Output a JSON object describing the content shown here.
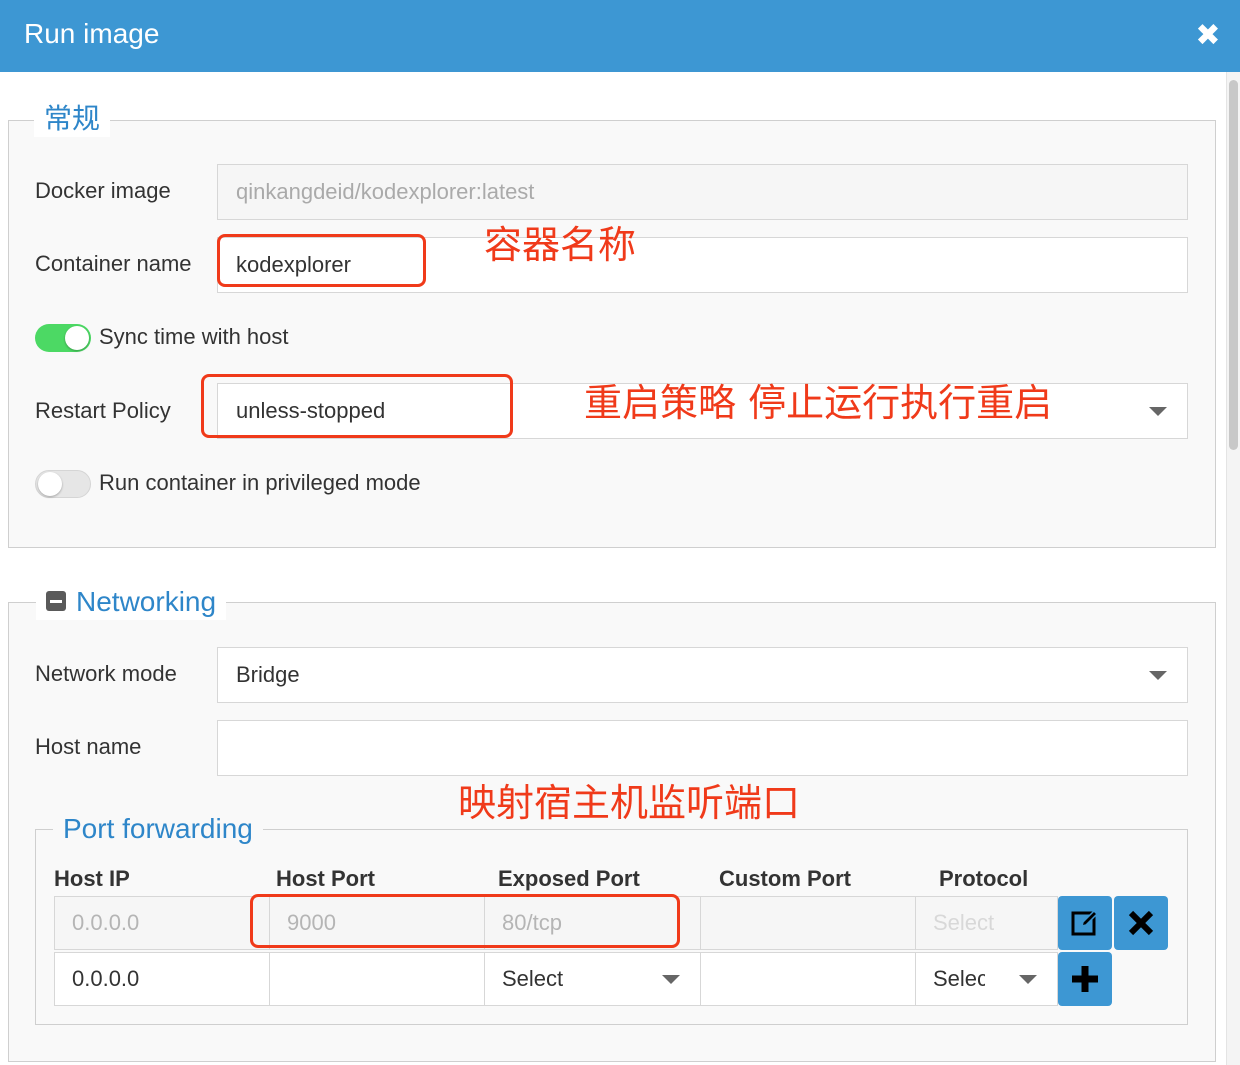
{
  "dialog": {
    "title": "Run image",
    "close_glyph": "✖"
  },
  "general": {
    "legend": "常规",
    "docker_image": {
      "label": "Docker image",
      "value": "qinkangdeid/kodexplorer:latest"
    },
    "container_name": {
      "label": "Container name",
      "value": "kodexplorer"
    },
    "sync_time": {
      "label": "Sync time with host",
      "on": true
    },
    "restart_policy": {
      "label": "Restart Policy",
      "value": "unless-stopped"
    },
    "privileged": {
      "label": "Run container in privileged mode",
      "on": false
    }
  },
  "networking": {
    "legend": "Networking",
    "network_mode": {
      "label": "Network mode",
      "value": "Bridge"
    },
    "host_name": {
      "label": "Host name",
      "value": ""
    }
  },
  "port_forwarding": {
    "legend": "Port forwarding",
    "columns": [
      "Host IP",
      "Host Port",
      "Exposed Port",
      "Custom Port",
      "Protocol"
    ],
    "rows": [
      {
        "host_ip": "0.0.0.0",
        "host_port": "9000",
        "exposed_port": "80/tcp",
        "custom_port": "",
        "protocol": "Select"
      },
      {
        "host_ip": "0.0.0.0",
        "host_port": "",
        "exposed_port": "Select",
        "custom_port": "",
        "protocol": "Select"
      }
    ]
  },
  "annotations": {
    "container_name": "容器名称",
    "restart_policy": "重启策略 停止运行执行重启",
    "port_mapping": "映射宿主机监听端口"
  },
  "colors": {
    "titlebar": "#3d97d3",
    "accent": "#2e86c9",
    "annotation": "#f03a1a",
    "toggle_on": "#4cd964"
  }
}
